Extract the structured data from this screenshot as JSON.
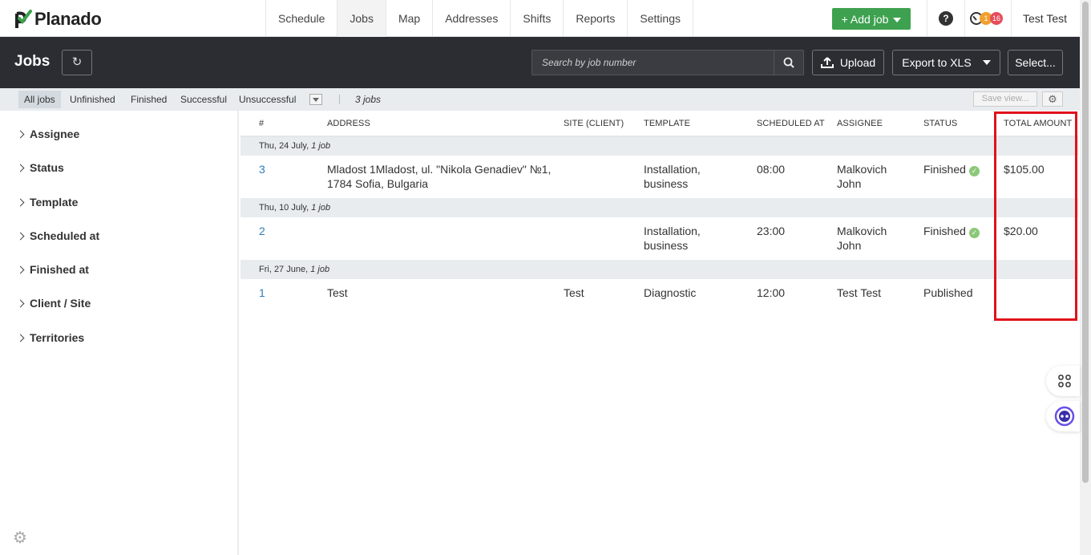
{
  "app": {
    "brand": "Planado"
  },
  "nav": {
    "items": [
      {
        "label": "Schedule",
        "active": false
      },
      {
        "label": "Jobs",
        "active": true
      },
      {
        "label": "Map",
        "active": false
      },
      {
        "label": "Addresses",
        "active": false
      },
      {
        "label": "Shifts",
        "active": false
      },
      {
        "label": "Reports",
        "active": false
      },
      {
        "label": "Settings",
        "active": false
      }
    ],
    "add_job_label": "+ Add job",
    "help_label": "?",
    "badge_orange": "1",
    "badge_red": "16",
    "user": "Test Test"
  },
  "header": {
    "title": "Jobs",
    "search_placeholder": "Search by job number",
    "upload_label": "Upload",
    "export_label": "Export to XLS",
    "select_label": "Select..."
  },
  "filters": {
    "tabs": [
      "All jobs",
      "Unfinished",
      "Finished",
      "Successful",
      "Unsuccessful"
    ],
    "active_tab": "All jobs",
    "count": "3 jobs",
    "save_view": "Save view..."
  },
  "sidebar": {
    "groups": [
      "Assignee",
      "Status",
      "Template",
      "Scheduled at",
      "Finished at",
      "Client / Site",
      "Territories"
    ]
  },
  "table": {
    "columns": [
      "#",
      "ADDRESS",
      "SITE (CLIENT)",
      "TEMPLATE",
      "SCHEDULED AT",
      "ASSIGNEE",
      "STATUS",
      "TOTAL AMOUNT"
    ],
    "groups": [
      {
        "date": "Thu, 24 July,",
        "count": "1 job",
        "rows": [
          {
            "num": "3",
            "address_1": "Mladost 1Mladost, ul. \"Nikola Genadiev\" №1,",
            "address_2": "1784 Sofia, Bulgaria",
            "site": "",
            "template_1": "Installation,",
            "template_2": "business",
            "scheduled": "08:00",
            "assignee_1": "Malkovich",
            "assignee_2": "John",
            "status": "Finished",
            "status_ok": true,
            "total": "$105.00"
          }
        ]
      },
      {
        "date": "Thu, 10 July,",
        "count": "1 job",
        "rows": [
          {
            "num": "2",
            "address_1": "",
            "address_2": "",
            "site": "",
            "template_1": "Installation,",
            "template_2": "business",
            "scheduled": "23:00",
            "assignee_1": "Malkovich",
            "assignee_2": "John",
            "status": "Finished",
            "status_ok": true,
            "total": "$20.00"
          }
        ]
      },
      {
        "date": "Fri, 27 June,",
        "count": "1 job",
        "rows": [
          {
            "num": "1",
            "address_1": "Test",
            "address_2": "",
            "site": "Test",
            "template_1": "Diagnostic",
            "template_2": "",
            "scheduled": "12:00",
            "assignee_1": "Test Test",
            "assignee_2": "",
            "status": "Published",
            "status_ok": false,
            "total": ""
          }
        ]
      }
    ]
  },
  "colors": {
    "accent_green": "#3ea150",
    "header_dark": "#2b2d33",
    "link_blue": "#2f7bb5",
    "highlight_red": "#e0121b"
  }
}
